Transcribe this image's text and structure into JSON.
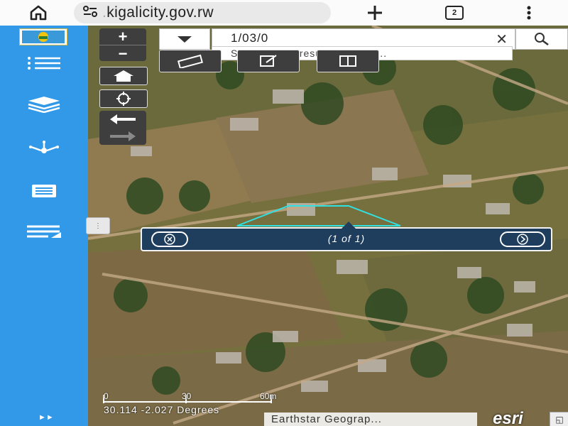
{
  "browser": {
    "url": "kigalicity.gov.rw",
    "url_prefix": ".",
    "tab_count": "2",
    "icons": [
      "home-icon",
      "site-info-icon",
      "new-tab-icon",
      "tabs-icon",
      "more-menu-icon"
    ]
  },
  "sidebar": {
    "items": [
      {
        "name": "list-icon"
      },
      {
        "name": "layers-icon"
      },
      {
        "name": "share-network-icon"
      },
      {
        "name": "document-icon"
      },
      {
        "name": "legend-icon"
      }
    ],
    "expand": "►►"
  },
  "map": {
    "search": {
      "value": "1/03/0",
      "suggestion": "Show search results for 1/03..."
    },
    "zoom": {
      "in": "+",
      "out": "−"
    },
    "popup": {
      "count": "(1 of 1)"
    },
    "scalebar": {
      "labels": [
        "0",
        "30",
        "60m"
      ]
    },
    "coordinates": "30.114 -2.027 Degrees",
    "attribution": "Earthstar Geograp...",
    "esri": "esri",
    "splitter": "⋮",
    "colors": {
      "sidebar": "#3199e8",
      "popup": "#1f3d5d",
      "selection": "#31e0e0"
    }
  }
}
